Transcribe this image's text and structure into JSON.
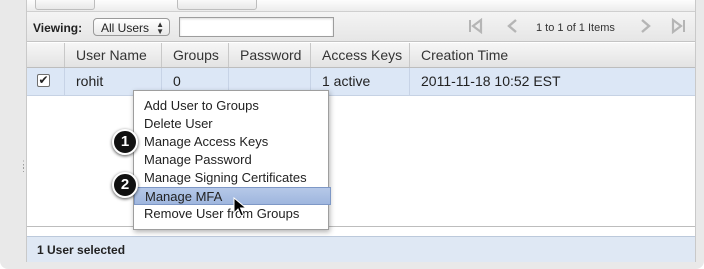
{
  "toolbar": {
    "viewing_label": "Viewing:",
    "filter_value": "All Users",
    "search_value": "",
    "pager_text": "1 to 1 of 1 Items"
  },
  "grid": {
    "columns": [
      "User Name",
      "Groups",
      "Password",
      "Access Keys",
      "Creation Time"
    ],
    "rows": [
      {
        "checked": true,
        "user_name": "rohit",
        "groups": "0",
        "password": "",
        "access_keys": "1 active",
        "creation_time": "2011-11-18 10:52 EST"
      }
    ]
  },
  "context_menu": {
    "items": [
      "Add User to Groups",
      "Delete User",
      "Manage Access Keys",
      "Manage Password",
      "Manage Signing Certificates",
      "Manage MFA",
      "Remove User from Groups"
    ],
    "highlighted": "Manage MFA"
  },
  "callouts": [
    "1",
    "2"
  ],
  "status_text": "1 User selected",
  "icons": {
    "first_page": "first-page-icon",
    "prev_page": "prev-page-icon",
    "next_page": "next-page-icon",
    "last_page": "last-page-icon",
    "check": "checkmark-icon",
    "cursor": "mouse-pointer-icon"
  }
}
